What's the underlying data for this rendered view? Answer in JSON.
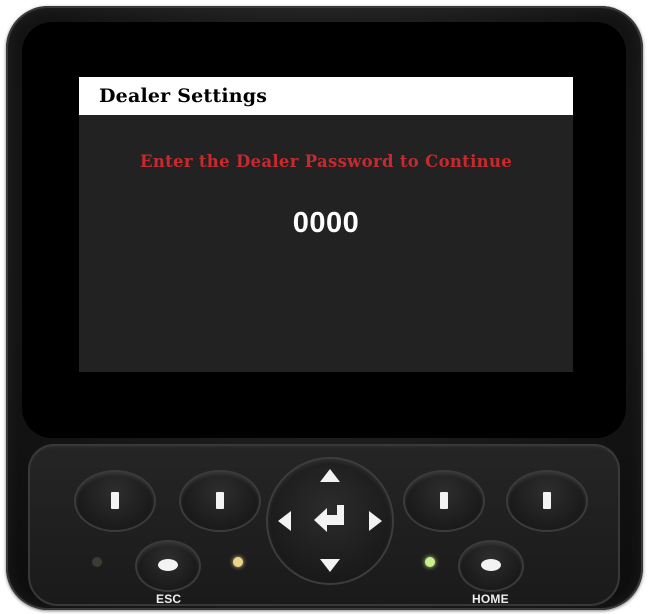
{
  "screen": {
    "title": "Dealer Settings",
    "prompt": "Enter the Dealer Password to Continue",
    "password_value": "0000"
  },
  "keypad": {
    "soft_keys": [
      {
        "icon": "bar-icon"
      },
      {
        "icon": "bar-icon"
      },
      {
        "icon": "bar-icon"
      },
      {
        "icon": "bar-icon"
      }
    ],
    "dpad": {
      "up_icon": "arrow-up-icon",
      "down_icon": "arrow-down-icon",
      "left_icon": "arrow-left-icon",
      "right_icon": "arrow-right-icon",
      "center_icon": "enter-icon"
    },
    "esc_label": "ESC",
    "home_label": "HOME",
    "leds": [
      {
        "name": "led-1",
        "color": "#3a3d36"
      },
      {
        "name": "led-2",
        "color": "#ead58a"
      },
      {
        "name": "led-3",
        "color": "#c9f08a"
      }
    ]
  },
  "colors": {
    "title_bar": "#ffffff",
    "screen_background": "#222222",
    "prompt_text": "#c62a2f",
    "password_text": "#ffffff",
    "device_body": "#151515"
  }
}
